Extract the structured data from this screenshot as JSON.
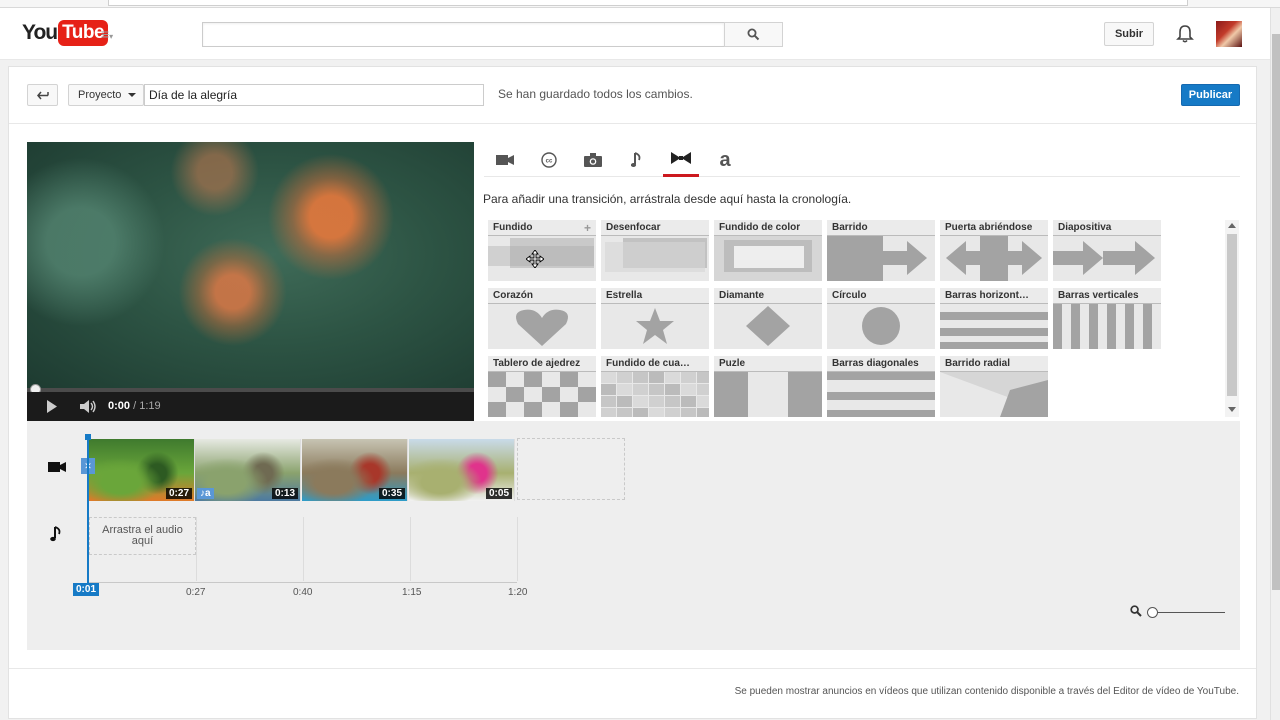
{
  "masthead": {
    "logo_you": "You",
    "logo_tube": "Tube",
    "search_placeholder": "",
    "upload_label": "Subir"
  },
  "editor": {
    "project_label": "Proyecto",
    "project_title": "Día de la alegría",
    "saved_status": "Se han guardado todos los cambios.",
    "publish_label": "Publicar"
  },
  "player": {
    "current_time": "0:00",
    "duration": "/ 1:19",
    "progress": 0.0
  },
  "tabs": [
    {
      "name": "video",
      "icon": "video-camera-icon"
    },
    {
      "name": "captions",
      "icon": "cc-icon"
    },
    {
      "name": "photos",
      "icon": "camera-icon"
    },
    {
      "name": "audio",
      "icon": "music-note-icon"
    },
    {
      "name": "transitions",
      "icon": "bowtie-icon",
      "active": true
    },
    {
      "name": "text",
      "icon": "text-a-icon"
    }
  ],
  "transitions_hint": "Para añadir una transición, arrástrala desde aquí hasta la cronología.",
  "transitions": [
    {
      "label": "Fundido",
      "pattern": "fade"
    },
    {
      "label": "Desenfocar",
      "pattern": "blur"
    },
    {
      "label": "Fundido de color",
      "pattern": "colorfade"
    },
    {
      "label": "Barrido",
      "pattern": "wipe"
    },
    {
      "label": "Puerta abriéndose",
      "pattern": "door"
    },
    {
      "label": "Diapositiva",
      "pattern": "slide"
    },
    {
      "label": "Corazón",
      "pattern": "heart"
    },
    {
      "label": "Estrella",
      "pattern": "star"
    },
    {
      "label": "Diamante",
      "pattern": "diamond"
    },
    {
      "label": "Círculo",
      "pattern": "circle"
    },
    {
      "label": "Barras horizont…",
      "pattern": "hbars"
    },
    {
      "label": "Barras verticales",
      "pattern": "vbars"
    },
    {
      "label": "Tablero de ajedrez",
      "pattern": "checker"
    },
    {
      "label": "Fundido de cua…",
      "pattern": "squares"
    },
    {
      "label": "Puzle",
      "pattern": "puzzle"
    },
    {
      "label": "Barras diagonales",
      "pattern": "dbars"
    },
    {
      "label": "Barrido radial",
      "pattern": "radial"
    }
  ],
  "timeline": {
    "clips": [
      {
        "duration": "0:27",
        "colors": [
          "#3f7a2e",
          "#6aa63a",
          "#e07a2a",
          "#2d5a22"
        ]
      },
      {
        "duration": "0:13",
        "colors": [
          "#e6e9e2",
          "#8aa26d",
          "#4d7aa0",
          "#6f6a52"
        ],
        "badge": "♪a"
      },
      {
        "duration": "0:35",
        "colors": [
          "#c7c4b3",
          "#8b7a5c",
          "#2d9cc9",
          "#a8372a"
        ]
      },
      {
        "duration": "0:05",
        "colors": [
          "#c9dbe9",
          "#a8b070",
          "#f1f1f1",
          "#e0338c"
        ]
      }
    ],
    "audio_drop": "Arrastra el audio aquí",
    "position": "0:01",
    "ticks": [
      "0:27",
      "0:40",
      "1:15",
      "1:20"
    ]
  },
  "footer": "Se pueden mostrar anuncios en vídeos que utilizan contenido disponible a través del Editor de vídeo de YouTube."
}
